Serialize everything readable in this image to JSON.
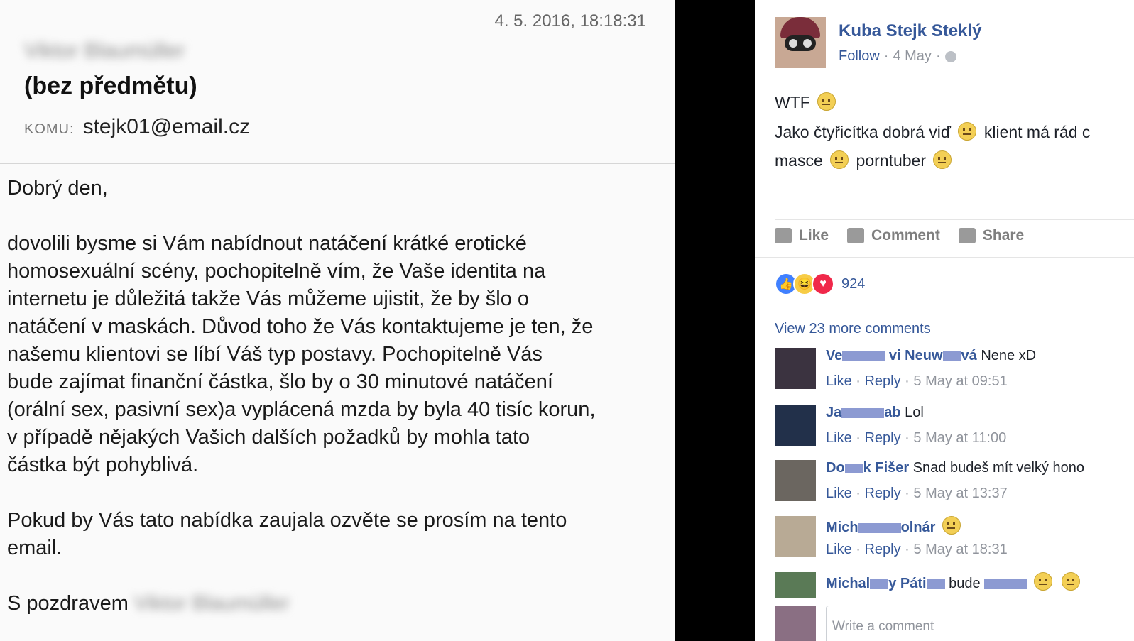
{
  "email": {
    "date": "4. 5. 2016, 18:18:31",
    "sender": "Viktor Blaumüller",
    "subject": "(bez předmětu)",
    "to_label": "KOMU:",
    "to_address": "stejk01@email.cz",
    "greeting": "Dobrý den,",
    "body_lines": [
      "dovolili bysme si Vám nabídnout natáčení krátké erotické",
      "homosexuální scény, pochopitelně vím, že Vaše identita na",
      "internetu je důležitá takže Vás můžeme ujistit, že by šlo o",
      "natáčení v maskách. Důvod toho že Vás kontaktujeme je ten, že",
      "našemu klientovi se líbí Váš typ postavy. Pochopitelně Vás",
      "bude zajímat finanční částka, šlo by o 30 minutové natáčení",
      "(orální sex, pasivní sex)a vyplácená mzda by byla 40 tisíc korun,",
      "v případě nějakých Vašich dalších požadků by mohla tato",
      "částka být pohyblivá."
    ],
    "closing_lines": [
      "Pokud by Vás tato nabídka zaujala ozvěte se prosím na tento",
      "email."
    ],
    "signoff": "S pozdravem",
    "signoff_name": "Viktor Blaumüller"
  },
  "facebook": {
    "author": "Kuba Stejk Steklý",
    "follow": "Follow",
    "date": "4 May",
    "post_line1": "WTF",
    "post_line2_a": "Jako čtyřicítka dobrá viď",
    "post_line2_b": "klient má rád c",
    "post_line3_a": "masce",
    "post_line3_b": "porntuber",
    "actions": {
      "like": "Like",
      "comment": "Comment",
      "share": "Share"
    },
    "reaction_count": "924",
    "view_more": "View 23 more comments",
    "comments": [
      {
        "name_a": "Ve",
        "name_b": "vi Neuw",
        "name_c": "vá",
        "text": "Nene xD",
        "like": "Like",
        "reply": "Reply",
        "time": "5 May at 09:51"
      },
      {
        "name_a": "Ja",
        "name_b": "ab",
        "name_c": "",
        "text": "Lol",
        "like": "Like",
        "reply": "Reply",
        "time": "5 May at 11:00"
      },
      {
        "name_a": "Do",
        "name_b": "k Fišer",
        "name_c": "",
        "text": "Snad budeš mít velký hono",
        "like": "Like",
        "reply": "Reply",
        "time": "5 May at 13:37"
      },
      {
        "name_a": "Mich",
        "name_b": "",
        "name_c": "olnár",
        "text": "",
        "like": "Like",
        "reply": "Reply",
        "time": "5 May at 18:31"
      },
      {
        "name_a": "Michal",
        "name_b": "y Páti",
        "name_c": "",
        "text": "bude",
        "like": "",
        "reply": "",
        "time": ""
      }
    ],
    "write_placeholder": "Write a comment"
  }
}
